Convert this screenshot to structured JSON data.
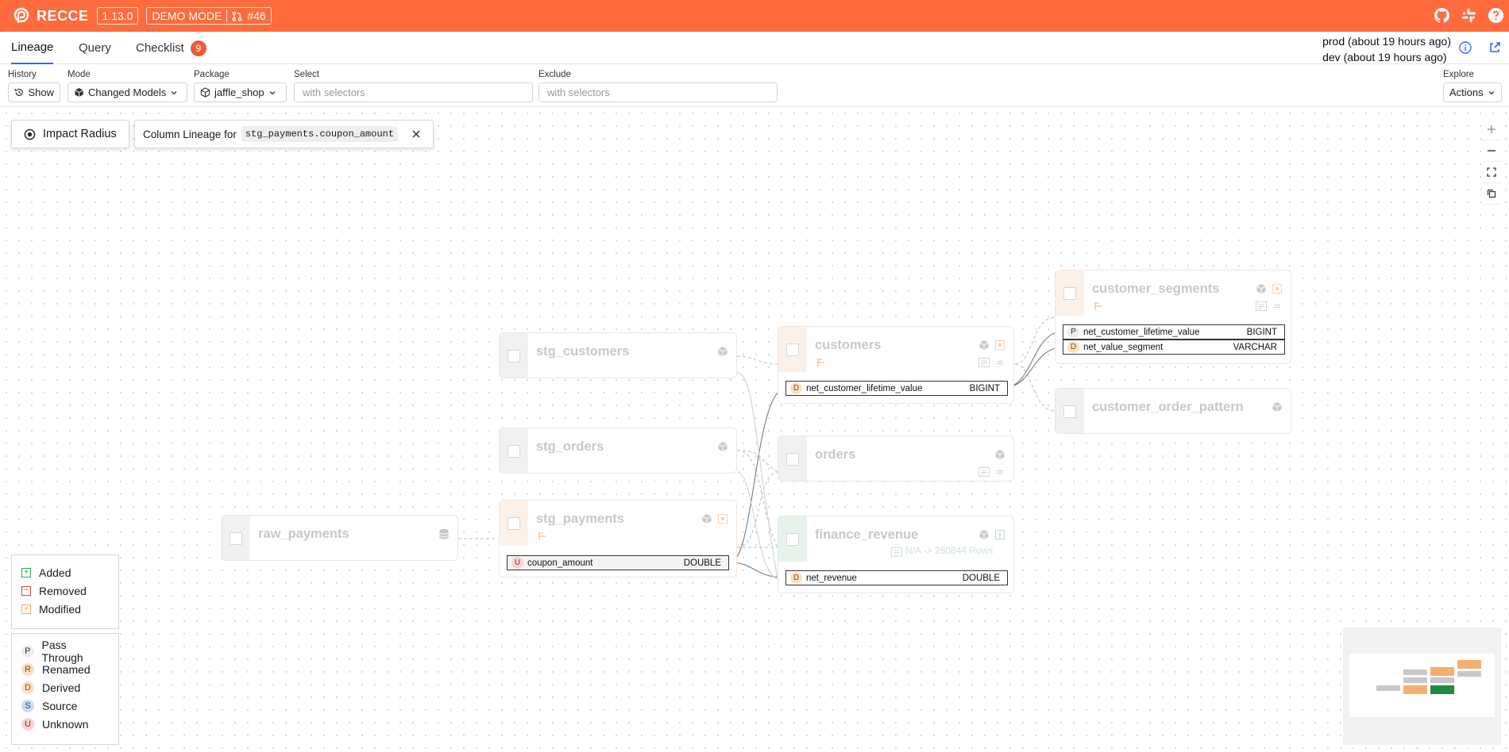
{
  "app": {
    "brand": "RECCE",
    "version": "1.13.0",
    "mode": "DEMO MODE",
    "pr": "#46",
    "header_icons": [
      "github-icon",
      "slack-icon",
      "help-icon"
    ]
  },
  "nav": {
    "tabs": [
      {
        "label": "Lineage",
        "active": true
      },
      {
        "label": "Query",
        "active": false
      },
      {
        "label": "Checklist",
        "active": false,
        "badge": "9"
      }
    ],
    "env_prod": "prod (about 19 hours ago)",
    "env_dev": "dev (about 19 hours ago)"
  },
  "filters": {
    "history_label": "History",
    "history_value": "Show",
    "mode_label": "Mode",
    "mode_value": "Changed Models",
    "package_label": "Package",
    "package_value": "jaffle_shop",
    "select_label": "Select",
    "select_placeholder": "with selectors",
    "exclude_label": "Exclude",
    "exclude_placeholder": "with selectors",
    "explore_label": "Explore",
    "explore_value": "Actions"
  },
  "canvas": {
    "impact_radius": "Impact Radius",
    "column_lineage_prefix": "Column Lineage for",
    "column_lineage_target": "stg_payments.coupon_amount"
  },
  "nodes": {
    "raw_payments": {
      "name": "raw_payments"
    },
    "stg_customers": {
      "name": "stg_customers"
    },
    "stg_orders": {
      "name": "stg_orders"
    },
    "stg_payments": {
      "name": "stg_payments",
      "column": {
        "badge": "U",
        "name": "coupon_amount",
        "type": "DOUBLE"
      }
    },
    "customers": {
      "name": "customers",
      "column": {
        "badge": "D",
        "name": "net_customer_lifetime_value",
        "type": "BIGINT"
      }
    },
    "orders": {
      "name": "orders"
    },
    "finance_revenue": {
      "name": "finance_revenue",
      "rows": "N/A -> 280844 Rows",
      "column": {
        "badge": "D",
        "name": "net_revenue",
        "type": "DOUBLE"
      }
    },
    "customer_segments": {
      "name": "customer_segments",
      "columns": [
        {
          "badge": "P",
          "name": "net_customer_lifetime_value",
          "type": "BIGINT"
        },
        {
          "badge": "D",
          "name": "net_value_segment",
          "type": "VARCHAR"
        }
      ]
    },
    "customer_order_pattern": {
      "name": "customer_order_pattern"
    }
  },
  "legend_change": [
    {
      "label": "Added"
    },
    {
      "label": "Removed"
    },
    {
      "label": "Modified"
    }
  ],
  "legend_column": [
    {
      "badge": "P",
      "label": "Pass Through"
    },
    {
      "badge": "R",
      "label": "Renamed"
    },
    {
      "badge": "D",
      "label": "Derived"
    },
    {
      "badge": "S",
      "label": "Source"
    },
    {
      "badge": "U",
      "label": "Unknown"
    }
  ],
  "colors": {
    "brand_orange": "#ff6b3d",
    "added": "#2ba35b",
    "removed": "#e2423c",
    "modified": "#f0a75a",
    "active_tab": "#2e6cf0"
  }
}
